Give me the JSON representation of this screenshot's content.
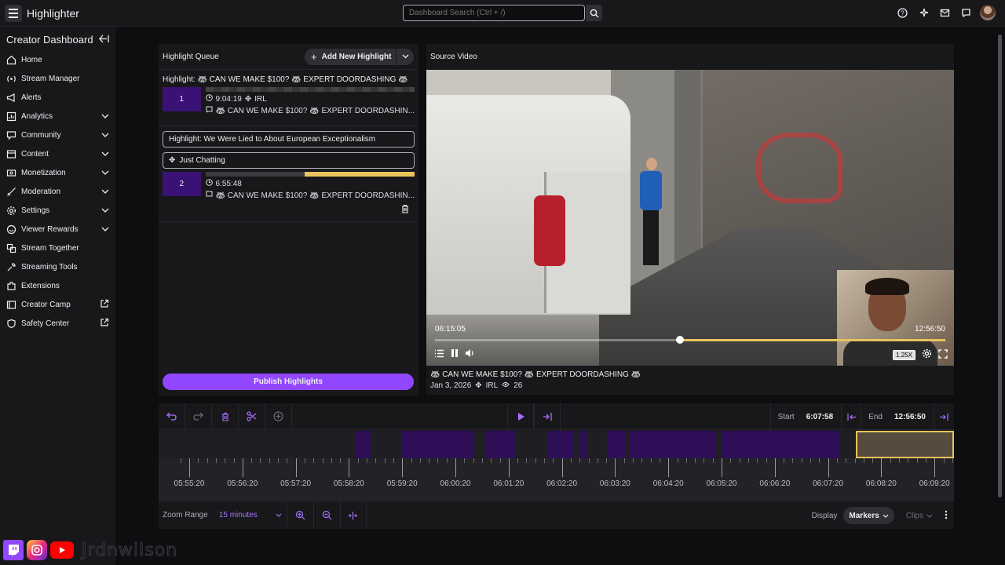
{
  "app": {
    "title": "Highlighter"
  },
  "search": {
    "placeholder": "Dashboard Search (Ctrl + /)"
  },
  "sidebar": {
    "title": "Creator Dashboard",
    "items": [
      {
        "label": "Home",
        "icon": "home-icon",
        "expand": false,
        "external": false
      },
      {
        "label": "Stream Manager",
        "icon": "broadcast-icon",
        "expand": false,
        "external": false
      },
      {
        "label": "Alerts",
        "icon": "megaphone-icon",
        "expand": false,
        "external": false
      },
      {
        "label": "Analytics",
        "icon": "analytics-icon",
        "expand": true,
        "external": false
      },
      {
        "label": "Community",
        "icon": "community-icon",
        "expand": true,
        "external": false
      },
      {
        "label": "Content",
        "icon": "content-icon",
        "expand": true,
        "external": false
      },
      {
        "label": "Monetization",
        "icon": "monetization-icon",
        "expand": true,
        "external": false
      },
      {
        "label": "Moderation",
        "icon": "sword-icon",
        "expand": true,
        "external": false
      },
      {
        "label": "Settings",
        "icon": "gear-icon",
        "expand": true,
        "external": false
      },
      {
        "label": "Viewer Rewards",
        "icon": "rewards-icon",
        "expand": true,
        "external": false
      },
      {
        "label": "Stream Together",
        "icon": "stream-together-icon",
        "expand": false,
        "external": false
      },
      {
        "label": "Streaming Tools",
        "icon": "tools-icon",
        "expand": false,
        "external": false
      },
      {
        "label": "Extensions",
        "icon": "extensions-icon",
        "expand": false,
        "external": false
      },
      {
        "label": "Creator Camp",
        "icon": "camp-icon",
        "expand": false,
        "external": true
      },
      {
        "label": "Safety Center",
        "icon": "shield-icon",
        "expand": false,
        "external": true
      }
    ]
  },
  "queue": {
    "title": "Highlight Queue",
    "add_label": "Add New Highlight",
    "entry1": {
      "title": "Highlight: 🦝 CAN WE MAKE $100? 🦝 EXPERT DOORDASHING 🦝",
      "number": "1",
      "duration": "9:04:19",
      "category": "IRL",
      "source": "🦝 CAN WE MAKE $100? 🦝 EXPERT DOORDASHIN..."
    },
    "entry2": {
      "title_value": "Highlight: We Were Lied to About European Exceptionalism",
      "category_value": "Just Chatting",
      "number": "2",
      "duration": "6:55:48",
      "source": "🦝 CAN WE MAKE $100? 🦝 EXPERT DOORDASHIN...",
      "progress_fraction": 0.5
    },
    "publish_label": "Publish Highlights"
  },
  "source_video": {
    "title": "Source Video",
    "current_time": "06:15:05",
    "end_time": "12:56:50",
    "speed": "1.25X",
    "playhead_fraction": 0.48,
    "stream_title": "🦝 CAN WE MAKE $100? 🦝 EXPERT DOORDASHING 🦝",
    "date": "Jan 3, 2026",
    "category": "IRL",
    "views": "26"
  },
  "timeline": {
    "start_label": "Start",
    "start_value": "6:07:58",
    "end_label": "End",
    "end_value": "12:56:50",
    "ruler_labels": [
      "05:55:20",
      "05:56:20",
      "05:57:20",
      "05:58:20",
      "05:59:20",
      "06:00:20",
      "06:01:20",
      "06:02:20",
      "06:03:20",
      "06:04:20",
      "06:05:20",
      "06:06:20",
      "06:07:20",
      "06:08:20",
      "06:09:20"
    ],
    "zoom_label": "Zoom Range",
    "zoom_value": "15 minutes",
    "display_label": "Display",
    "markers_label": "Markers",
    "clips_label": "Clips"
  },
  "watermark": {
    "handle": "Jrdnwilson"
  },
  "colors": {
    "accent": "#9147ff",
    "gold": "#e8c35a",
    "segment": "#2e0f57"
  }
}
